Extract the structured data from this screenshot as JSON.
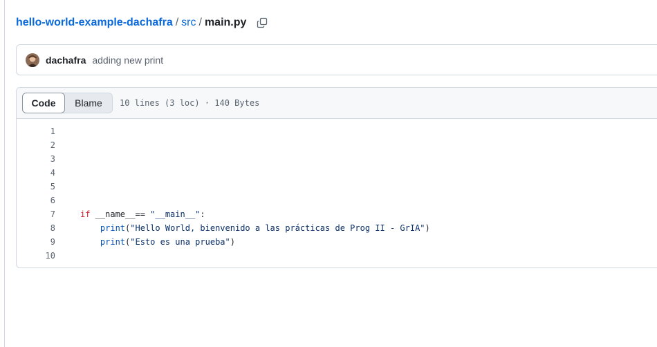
{
  "breadcrumb": {
    "repo": "hello-world-example-dachafra",
    "sep1": "/",
    "folder": "src",
    "sep2": "/",
    "file": "main.py",
    "copy_icon": "copy-icon"
  },
  "commit": {
    "author": "dachafra",
    "message": "adding new print"
  },
  "file_header": {
    "tabs": [
      {
        "label": "Code",
        "active": true
      },
      {
        "label": "Blame",
        "active": false
      }
    ],
    "meta": "10 lines (3 loc) · 140 Bytes"
  },
  "code": {
    "line_numbers": [
      "1",
      "2",
      "3",
      "4",
      "5",
      "6",
      "7",
      "8",
      "9",
      "10"
    ],
    "line7": {
      "kw": "if",
      "rest": " __name__== ",
      "str": "\"__main__\"",
      "end": ":"
    },
    "line8": {
      "indent": "    ",
      "fn": "print",
      "open": "(",
      "str": "\"Hello World, bienvenido a las prácticas de Prog II - GrIA\"",
      "close": ")"
    },
    "line9": {
      "indent": "    ",
      "fn": "print",
      "open": "(",
      "str": "\"Esto es una prueba\"",
      "close": ")"
    }
  },
  "colors": {
    "link": "#0969da",
    "keyword": "#cf222e",
    "function": "#0550ae",
    "string": "#0a3069",
    "border": "#d1d9e0",
    "header_bg": "#f6f8fa"
  }
}
